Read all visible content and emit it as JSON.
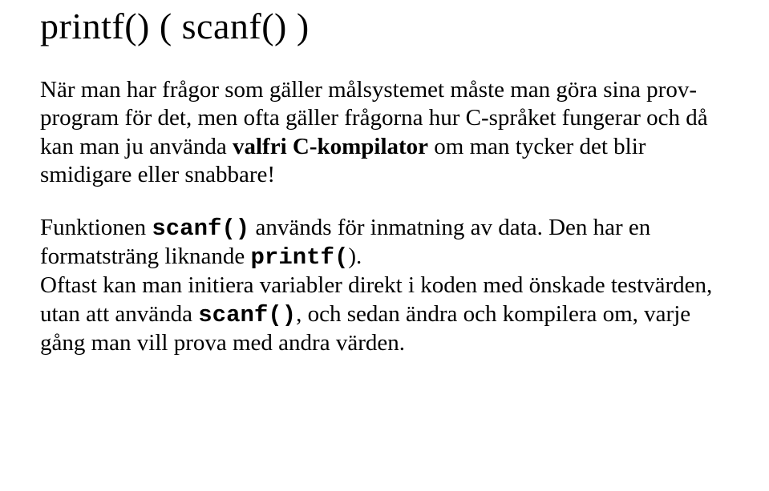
{
  "title": "printf()  (  scanf()  )",
  "p1_part1": "När man har frågor som gäller målsystemet måste man göra sina prov-program för det, men ofta gäller frågorna hur C-språket fungerar och då kan man ju använda ",
  "p1_bold": "valfri C-kompilator",
  "p1_part2": " om man tycker det blir smidigare eller snabbare!",
  "p2_part1": "Funktionen ",
  "p2_code1": "scanf()",
  "p2_part2": " används för inmatning av data. Den har en formatsträng liknande ",
  "p2_code2": "printf(",
  "p2_part3": ").",
  "p3_part1": "Oftast kan man initiera variabler direkt i koden med önskade testvärden, utan att använda ",
  "p3_code1": "scanf()",
  "p3_part2": ", och sedan ändra och kompilera om, varje gång man vill prova med andra värden.",
  "p2_br": "\n"
}
